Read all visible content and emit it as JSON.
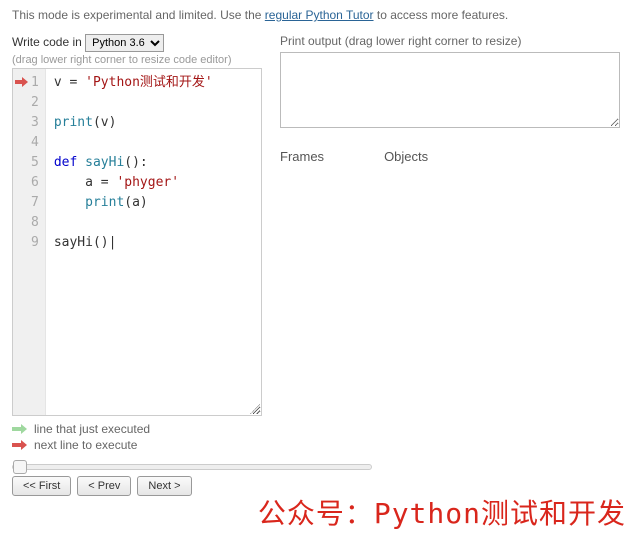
{
  "notice": {
    "prefix": "This mode is experimental and limited. Use the",
    "link_text": "regular Python Tutor",
    "suffix": "to access more features."
  },
  "left": {
    "write_label": "Write code in",
    "lang_selected": "Python 3.6",
    "resize_hint": "(drag lower right corner to resize code editor)",
    "code_lines": [
      "v = 'Python测试和开发'",
      "",
      "print(v)",
      "",
      "def sayHi():",
      "    a = 'phyger'",
      "    print(a)",
      "",
      "sayHi()"
    ],
    "arrow_line": 1,
    "legend_executed": "line that just executed",
    "legend_next": "next line to execute"
  },
  "right": {
    "output_label": "Print output (drag lower right corner to resize)",
    "output_value": "",
    "frames_label": "Frames",
    "objects_label": "Objects"
  },
  "controls": {
    "first": "<< First",
    "prev": "< Prev",
    "next": "Next >"
  },
  "watermark": "公众号：Python测试和开发"
}
